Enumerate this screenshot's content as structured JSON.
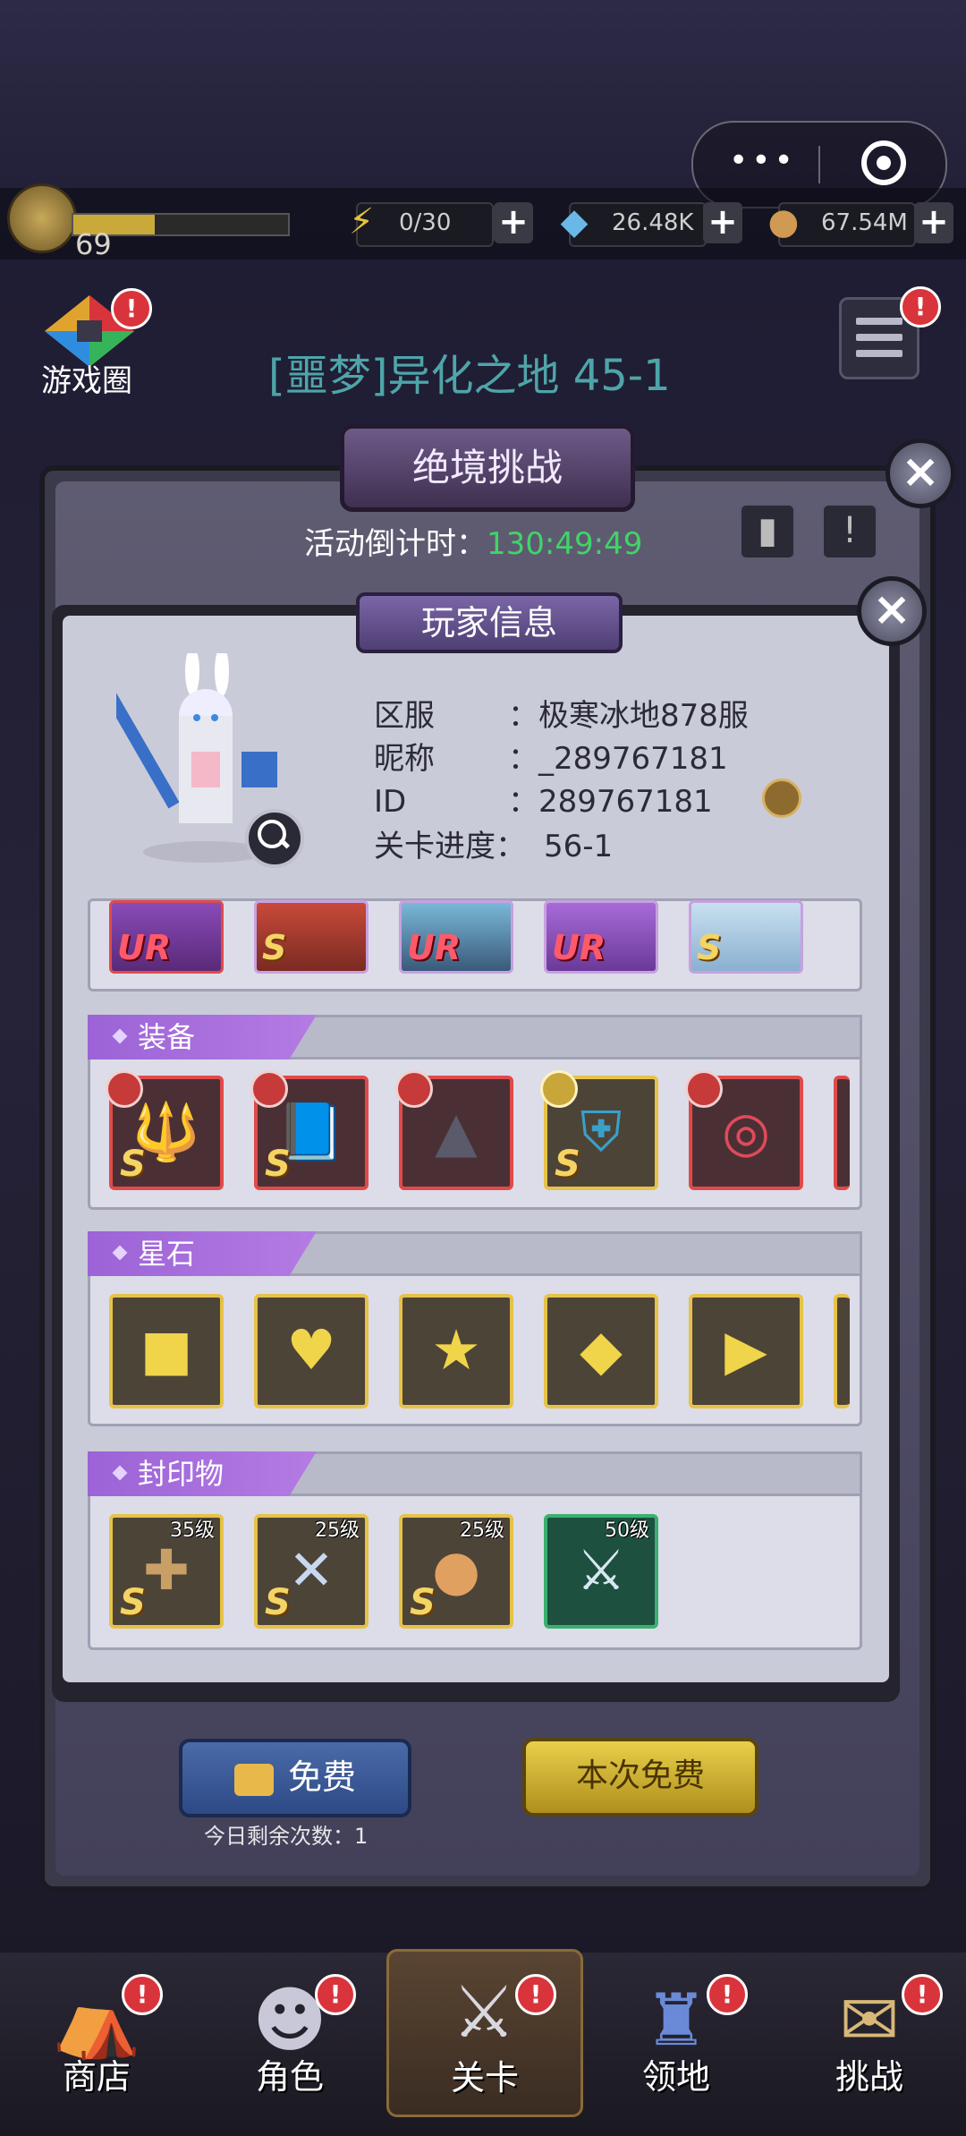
{
  "topbar": {
    "level": "69",
    "energy": "0/30",
    "diamonds": "26.48K",
    "coins": "67.54M",
    "plus": "+"
  },
  "scene": {
    "game_circle_label": "游戏圈",
    "stage_title": "[噩梦]异化之地 45-1",
    "badge": "!"
  },
  "challenge": {
    "title": "绝境挑战",
    "countdown_label": "活动倒计时：",
    "countdown_value": "130:49:49",
    "free_label": "免费",
    "remaining_label": "今日剩余次数：1",
    "this_free_label": "本次免费",
    "close": "×"
  },
  "player_info": {
    "title": "玩家信息",
    "close": "×",
    "rows": [
      {
        "key": "区服",
        "value": "：极寒冰地878服"
      },
      {
        "key": "昵称",
        "value": "：_289767181"
      },
      {
        "key": "ID",
        "value": "：289767181"
      },
      {
        "key": "关卡进度：",
        "value": "56-1"
      }
    ],
    "heroes": [
      "UR",
      "S",
      "UR",
      "UR",
      "S"
    ],
    "sections": {
      "equipment": {
        "label": "装备",
        "items": [
          {
            "icon": "trident-icon",
            "rank": "S",
            "color": "red"
          },
          {
            "icon": "spellbook-icon",
            "rank": "S",
            "color": "red"
          },
          {
            "icon": "wizard-hat-icon",
            "rank": "",
            "color": "red"
          },
          {
            "icon": "armor-icon",
            "rank": "S",
            "color": "gold"
          },
          {
            "icon": "ring-icon",
            "rank": "",
            "color": "red"
          }
        ]
      },
      "star_stones": {
        "label": "星石",
        "items": [
          {
            "icon": "square-gem-icon"
          },
          {
            "icon": "heart-gem-icon"
          },
          {
            "icon": "star-gem-icon"
          },
          {
            "icon": "diamond-gem-icon"
          },
          {
            "icon": "triangle-gem-icon"
          }
        ]
      },
      "seals": {
        "label": "封印物",
        "items": [
          {
            "icon": "voodoo-doll-icon",
            "rank": "S",
            "level": "35级"
          },
          {
            "icon": "crossed-utensils-icon",
            "rank": "S",
            "level": "25级"
          },
          {
            "icon": "coin-icon",
            "rank": "S",
            "level": "25级"
          },
          {
            "icon": "sword-icon",
            "rank": "",
            "level": "50级"
          }
        ]
      }
    }
  },
  "nav": {
    "shop": "商店",
    "character": "角色",
    "stage": "关卡",
    "territory": "领地",
    "challenge": "挑战"
  },
  "colors": {
    "countdown": "#40d468",
    "stage_title": "#4ea5a9",
    "section_tag": "#9b63d6"
  }
}
